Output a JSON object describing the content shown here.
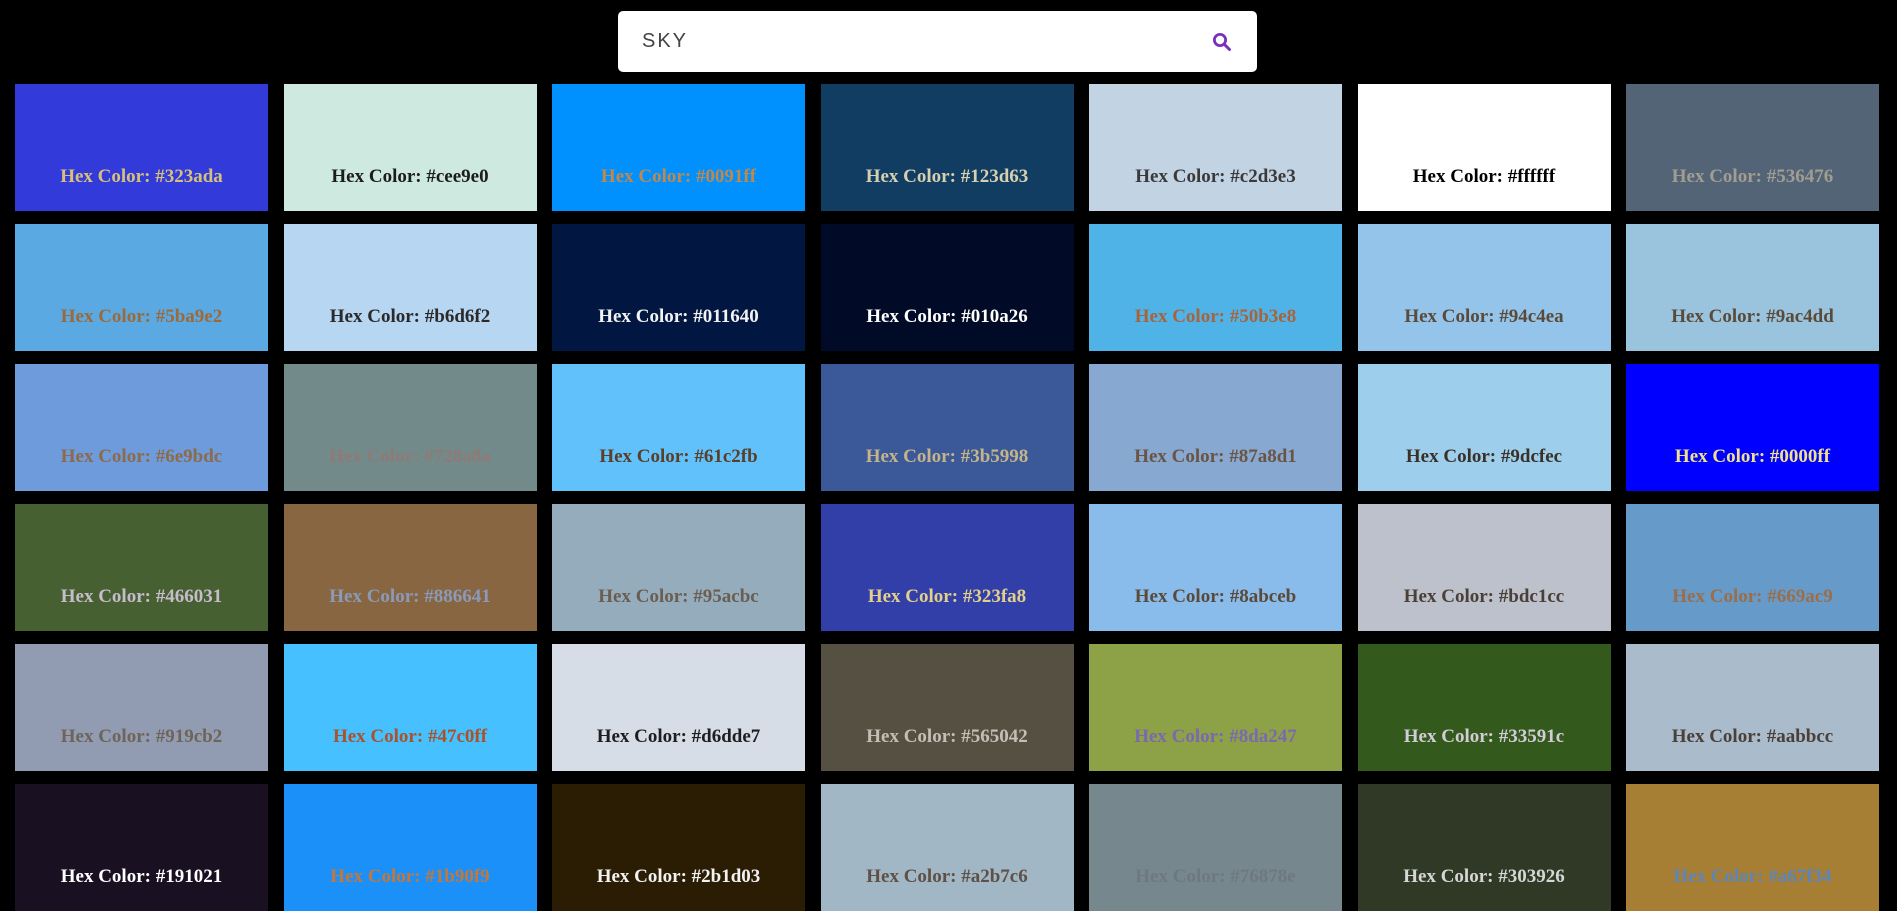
{
  "search": {
    "value": "SKY",
    "icon": "search-icon",
    "icon_color": "#7b2fbf"
  },
  "label_prefix": "Hex Color: ",
  "swatches": [
    {
      "hex": "#323ada",
      "text": "#d6c07a"
    },
    {
      "hex": "#cee9e0",
      "text": "#1c1c1c"
    },
    {
      "hex": "#0091ff",
      "text": "#c2884a"
    },
    {
      "hex": "#123d63",
      "text": "#d6cfb0"
    },
    {
      "hex": "#c2d3e3",
      "text": "#3a3a3a"
    },
    {
      "hex": "#ffffff",
      "text": "#000000"
    },
    {
      "hex": "#536476",
      "text": "#a09d92"
    },
    {
      "hex": "#5ba9e2",
      "text": "#9c6a3a"
    },
    {
      "hex": "#b6d6f2",
      "text": "#2a2a2a"
    },
    {
      "hex": "#011640",
      "text": "#f2f2f2"
    },
    {
      "hex": "#010a26",
      "text": "#ffffff"
    },
    {
      "hex": "#50b3e8",
      "text": "#a7643c"
    },
    {
      "hex": "#94c4ea",
      "text": "#5a4a3a"
    },
    {
      "hex": "#9ac4dd",
      "text": "#5a4a3a"
    },
    {
      "hex": "#6e9bdc",
      "text": "#8c6a4a"
    },
    {
      "hex": "#728a8a",
      "text": "#8e7a76"
    },
    {
      "hex": "#61c2fb",
      "text": "#5a3e2a"
    },
    {
      "hex": "#3b5998",
      "text": "#c4b48a"
    },
    {
      "hex": "#87a8d1",
      "text": "#6a5444"
    },
    {
      "hex": "#9dcfec",
      "text": "#3a3028"
    },
    {
      "hex": "#0000ff",
      "text": "#f0e28a"
    },
    {
      "hex": "#466031",
      "text": "#c6bccc"
    },
    {
      "hex": "#886641",
      "text": "#8a9ab8"
    },
    {
      "hex": "#95acbc",
      "text": "#6a5e52"
    },
    {
      "hex": "#323fa8",
      "text": "#e2d08a"
    },
    {
      "hex": "#8abceb",
      "text": "#5a4a3a"
    },
    {
      "hex": "#bdc1cc",
      "text": "#4a4038"
    },
    {
      "hex": "#669ac9",
      "text": "#9a6e4a"
    },
    {
      "hex": "#919cb2",
      "text": "#6e6458"
    },
    {
      "hex": "#47c0ff",
      "text": "#a8532a"
    },
    {
      "hex": "#d6dde7",
      "text": "#1e1e1e"
    },
    {
      "hex": "#565042",
      "text": "#c2c0b6"
    },
    {
      "hex": "#8da247",
      "text": "#7a68b0"
    },
    {
      "hex": "#33591c",
      "text": "#d2ccd8"
    },
    {
      "hex": "#aabbcc",
      "text": "#4a4038"
    },
    {
      "hex": "#191021",
      "text": "#ffffff"
    },
    {
      "hex": "#1b90f9",
      "text": "#c2783a"
    },
    {
      "hex": "#2b1d03",
      "text": "#f2f2f2"
    },
    {
      "hex": "#a2b7c6",
      "text": "#5e5044"
    },
    {
      "hex": "#76878e",
      "text": "#6f7880"
    },
    {
      "hex": "#303926",
      "text": "#d6d6d6"
    },
    {
      "hex": "#a67f34",
      "text": "#5e85b8"
    }
  ]
}
